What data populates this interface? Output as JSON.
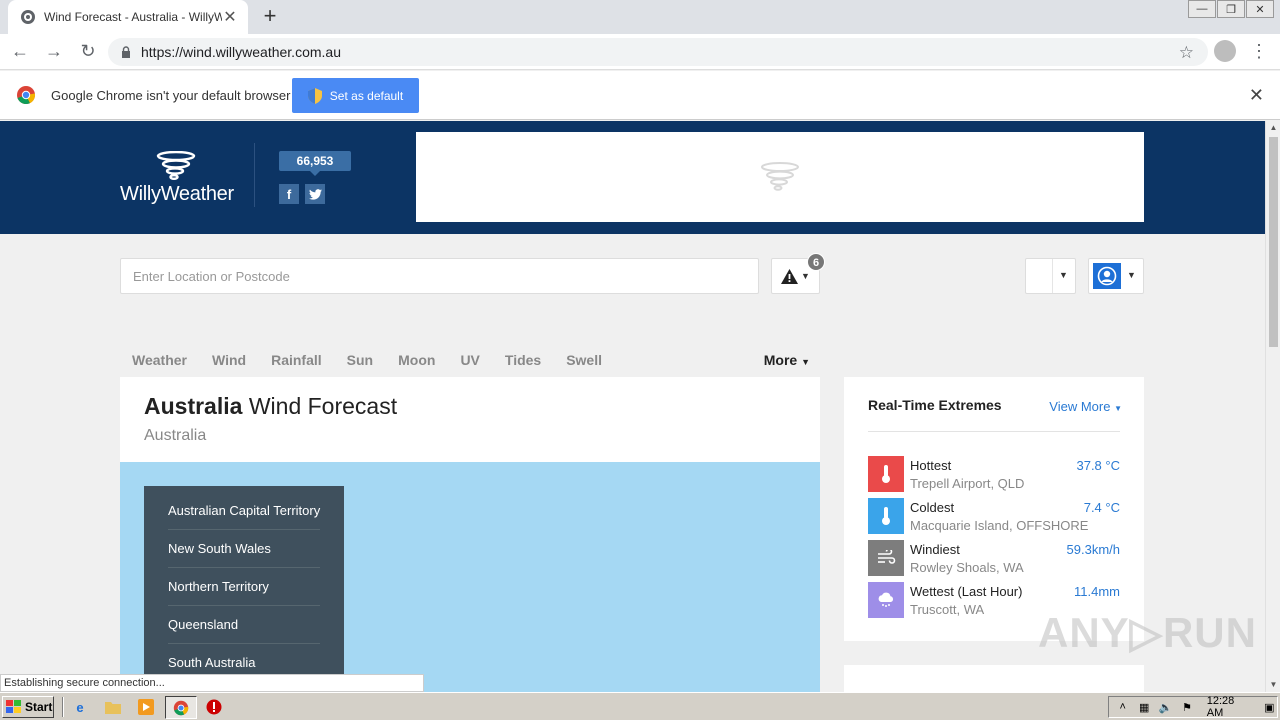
{
  "browser": {
    "tab_title": "Wind Forecast - Australia - WillyWea",
    "tab_close": "✕",
    "new_tab": "+",
    "url": "https://wind.willyweather.com.au",
    "infobar_message": "Google Chrome isn't your default browser",
    "set_default_label": "Set as default",
    "status_text": "Establishing secure connection..."
  },
  "header": {
    "logo_text": "WillyWeather",
    "social_count": "66,953",
    "facebook_glyph": "f",
    "twitter_glyph": "t"
  },
  "search": {
    "placeholder": "Enter Location or Postcode"
  },
  "alerts": {
    "count": "6"
  },
  "nav": {
    "items": [
      "Weather",
      "Wind",
      "Rainfall",
      "Sun",
      "Moon",
      "UV",
      "Tides",
      "Swell"
    ],
    "more_label": "More"
  },
  "main": {
    "title_bold": "Australia",
    "title_rest": " Wind Forecast",
    "subtitle": "Australia",
    "states": [
      "Australian Capital Territory",
      "New South Wales",
      "Northern Territory",
      "Queensland",
      "South Australia"
    ]
  },
  "extremes": {
    "title": "Real-Time Extremes",
    "view_more": "View More",
    "items": [
      {
        "label": "Hottest",
        "place": "Trepell Airport, QLD",
        "value": "37.8 °C",
        "color": "#ea4a4a"
      },
      {
        "label": "Coldest",
        "place": "Macquarie Island, OFFSHORE",
        "value": "7.4 °C",
        "color": "#3aa4ea"
      },
      {
        "label": "Windiest",
        "place": "Rowley Shoals, WA",
        "value": "59.3km/h",
        "color": "#7d7d7d"
      },
      {
        "label": "Wettest (Last Hour)",
        "place": "Truscott, WA",
        "value": "11.4mm",
        "color": "#9e8ee8"
      }
    ]
  },
  "watermark": "ANY▷RUN",
  "taskbar": {
    "start_label": "Start",
    "clock": "12:28 AM"
  }
}
